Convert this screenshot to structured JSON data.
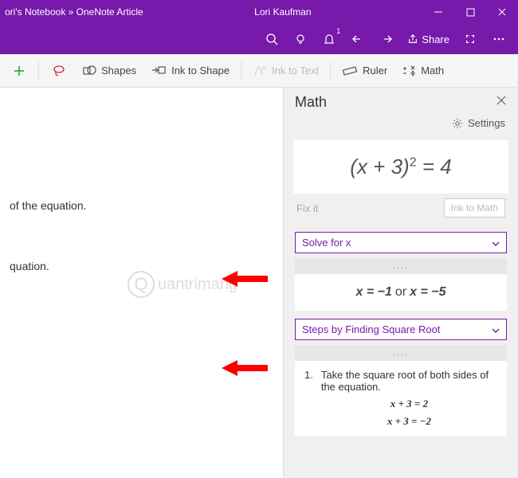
{
  "titlebar": {
    "breadcrumb": "ori's Notebook » OneNote Article",
    "user": "Lori Kaufman"
  },
  "cmdbar": {
    "notif_count": "1",
    "share_label": "Share"
  },
  "toolbar": {
    "shapes": "Shapes",
    "ink_to_shape": "Ink to Shape",
    "ink_to_text": "Ink to Text",
    "ruler": "Ruler",
    "math": "Math"
  },
  "canvas": {
    "line1": "of the equation.",
    "line2": "quation."
  },
  "mathpane": {
    "title": "Math",
    "settings": "Settings",
    "equation_lhs": "(x + 3)",
    "equation_exp": "2",
    "equation_rhs": " = 4",
    "fix_it": "Fix it",
    "ink_to_math": "Ink to Math",
    "dropdown1": "Solve for x",
    "dots": "....",
    "sol_a": "x = −1",
    "sol_or": "or",
    "sol_b": "x = −5",
    "dropdown2": "Steps by Finding Square Root",
    "step_num": "1.",
    "step_text": "Take the square root of both sides of the equation.",
    "step_eq1": "x + 3 = 2",
    "step_eq2": "x + 3 = −2"
  },
  "watermark": "uantrimang"
}
